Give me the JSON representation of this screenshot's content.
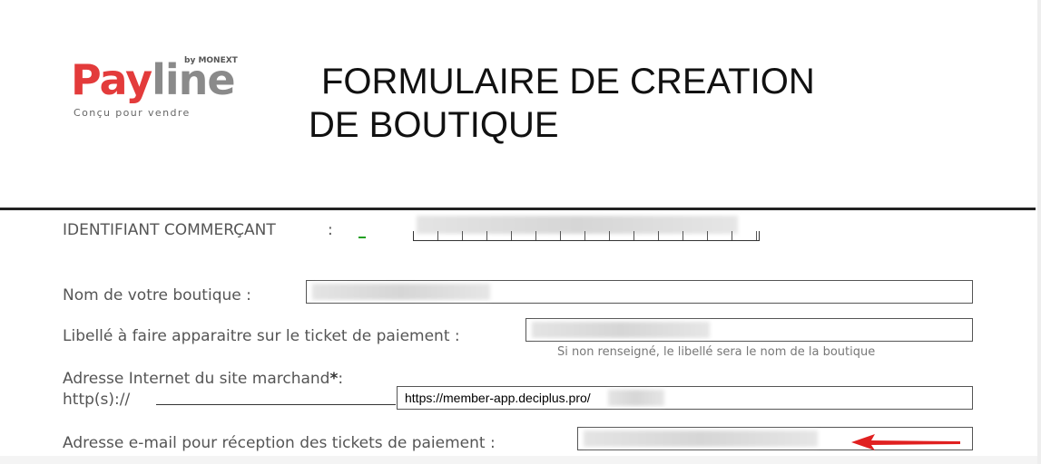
{
  "header": {
    "logo": {
      "brand_part1": "Pay",
      "brand_part2": "line",
      "byline": "by MONEXT",
      "tagline": "Conçu pour vendre"
    },
    "title_line1": "FORMULAIRE DE CREATION",
    "title_line2": "DE BOUTIQUE"
  },
  "form": {
    "merchant_id": {
      "label": "IDENTIFIANT COMMERÇANT",
      "separator": ":"
    },
    "shop_name": {
      "label": "Nom de votre boutique :"
    },
    "ticket_label": {
      "label": "Libellé à faire apparaitre sur le ticket de paiement :",
      "hint": "Si non renseigné, le libellé sera le nom de la boutique"
    },
    "website": {
      "label": "Adresse Internet du site marchand",
      "required_mark": "*",
      "label_suffix": ":",
      "prefix": "http(s)://",
      "value": "https://member-app.deciplus.pro/"
    },
    "email": {
      "label": "Adresse e-mail pour réception des tickets de paiement :"
    }
  },
  "colors": {
    "brand_red": "#e33b3b",
    "brand_grey": "#8a8a8a",
    "arrow_red": "#e02020",
    "divider": "#222222"
  }
}
